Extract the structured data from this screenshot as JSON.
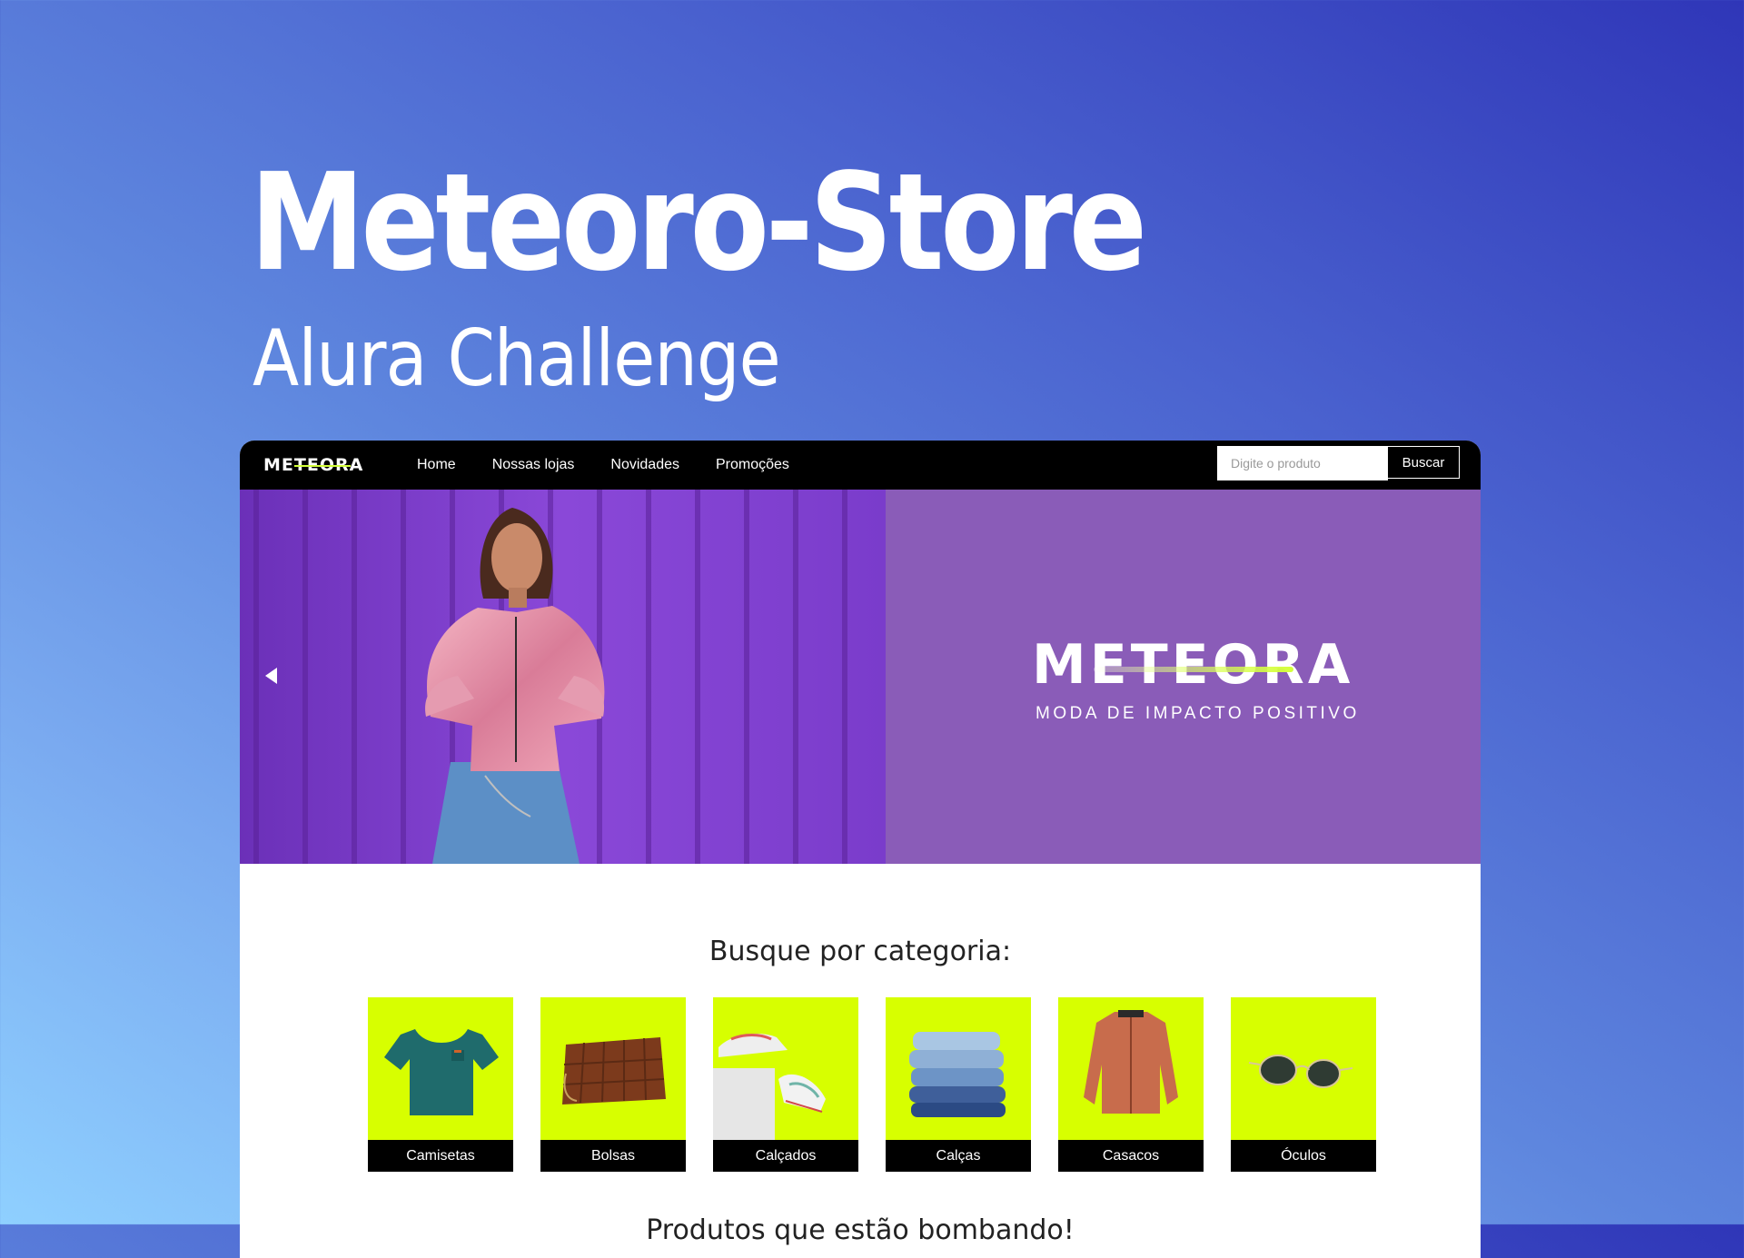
{
  "page": {
    "title": "Meteoro-Store",
    "subtitle": "Alura Challenge"
  },
  "navbar": {
    "logo": "METEORA",
    "links": [
      "Home",
      "Nossas lojas",
      "Novidades",
      "Promoções"
    ],
    "search_placeholder": "Digite o produto",
    "search_button": "Buscar"
  },
  "hero": {
    "brand": "METEORA",
    "tagline": "MODA DE IMPACTO POSITIVO",
    "prev_icon": "chevron-left-icon"
  },
  "categories": {
    "heading": "Busque por categoria:",
    "items": [
      {
        "label": "Camisetas",
        "icon": "tshirt-icon"
      },
      {
        "label": "Bolsas",
        "icon": "handbag-icon"
      },
      {
        "label": "Calçados",
        "icon": "sneakers-icon"
      },
      {
        "label": "Calças",
        "icon": "jeans-icon"
      },
      {
        "label": "Casacos",
        "icon": "jacket-icon"
      },
      {
        "label": "Óculos",
        "icon": "sunglasses-icon"
      }
    ]
  },
  "products": {
    "heading": "Produtos que estão bombando!"
  },
  "colors": {
    "accent": "#d7ff00",
    "hero_purple": "#8a5cb8",
    "nav_black": "#000000"
  }
}
